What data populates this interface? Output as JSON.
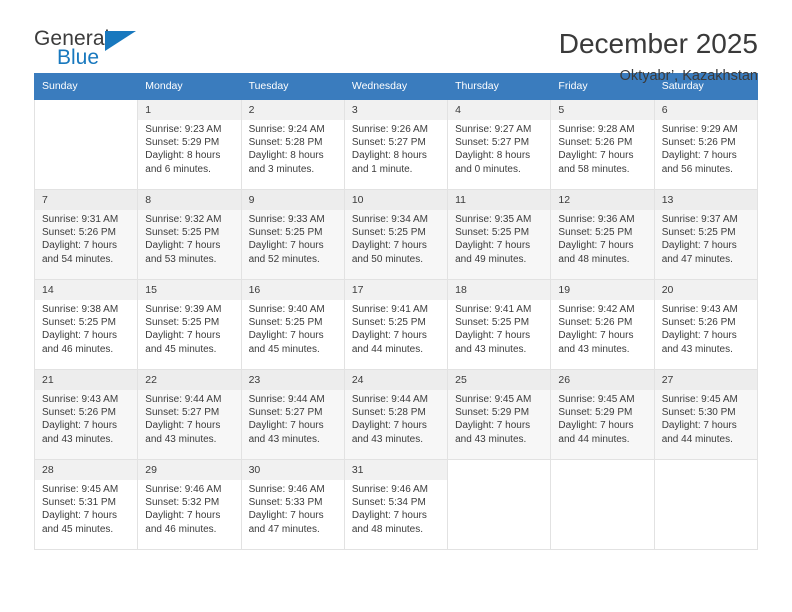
{
  "logo": {
    "word_one": "General",
    "word_two": "Blue",
    "triangle_icon": "triangle-icon",
    "brand_color": "#1878be"
  },
  "header": {
    "title": "December 2025",
    "subtitle": "Oktyabr’, Kazakhstan"
  },
  "calendar": {
    "header_bg": "#3a7cbe",
    "weekdays": [
      "Sunday",
      "Monday",
      "Tuesday",
      "Wednesday",
      "Thursday",
      "Friday",
      "Saturday"
    ],
    "weeks": [
      [
        {
          "day": "",
          "sunrise": "",
          "sunset": "",
          "daylight1": "",
          "daylight2": ""
        },
        {
          "day": "1",
          "sunrise": "Sunrise: 9:23 AM",
          "sunset": "Sunset: 5:29 PM",
          "daylight1": "Daylight: 8 hours",
          "daylight2": "and 6 minutes."
        },
        {
          "day": "2",
          "sunrise": "Sunrise: 9:24 AM",
          "sunset": "Sunset: 5:28 PM",
          "daylight1": "Daylight: 8 hours",
          "daylight2": "and 3 minutes."
        },
        {
          "day": "3",
          "sunrise": "Sunrise: 9:26 AM",
          "sunset": "Sunset: 5:27 PM",
          "daylight1": "Daylight: 8 hours",
          "daylight2": "and 1 minute."
        },
        {
          "day": "4",
          "sunrise": "Sunrise: 9:27 AM",
          "sunset": "Sunset: 5:27 PM",
          "daylight1": "Daylight: 8 hours",
          "daylight2": "and 0 minutes."
        },
        {
          "day": "5",
          "sunrise": "Sunrise: 9:28 AM",
          "sunset": "Sunset: 5:26 PM",
          "daylight1": "Daylight: 7 hours",
          "daylight2": "and 58 minutes."
        },
        {
          "day": "6",
          "sunrise": "Sunrise: 9:29 AM",
          "sunset": "Sunset: 5:26 PM",
          "daylight1": "Daylight: 7 hours",
          "daylight2": "and 56 minutes."
        }
      ],
      [
        {
          "day": "7",
          "sunrise": "Sunrise: 9:31 AM",
          "sunset": "Sunset: 5:26 PM",
          "daylight1": "Daylight: 7 hours",
          "daylight2": "and 54 minutes."
        },
        {
          "day": "8",
          "sunrise": "Sunrise: 9:32 AM",
          "sunset": "Sunset: 5:25 PM",
          "daylight1": "Daylight: 7 hours",
          "daylight2": "and 53 minutes."
        },
        {
          "day": "9",
          "sunrise": "Sunrise: 9:33 AM",
          "sunset": "Sunset: 5:25 PM",
          "daylight1": "Daylight: 7 hours",
          "daylight2": "and 52 minutes."
        },
        {
          "day": "10",
          "sunrise": "Sunrise: 9:34 AM",
          "sunset": "Sunset: 5:25 PM",
          "daylight1": "Daylight: 7 hours",
          "daylight2": "and 50 minutes."
        },
        {
          "day": "11",
          "sunrise": "Sunrise: 9:35 AM",
          "sunset": "Sunset: 5:25 PM",
          "daylight1": "Daylight: 7 hours",
          "daylight2": "and 49 minutes."
        },
        {
          "day": "12",
          "sunrise": "Sunrise: 9:36 AM",
          "sunset": "Sunset: 5:25 PM",
          "daylight1": "Daylight: 7 hours",
          "daylight2": "and 48 minutes."
        },
        {
          "day": "13",
          "sunrise": "Sunrise: 9:37 AM",
          "sunset": "Sunset: 5:25 PM",
          "daylight1": "Daylight: 7 hours",
          "daylight2": "and 47 minutes."
        }
      ],
      [
        {
          "day": "14",
          "sunrise": "Sunrise: 9:38 AM",
          "sunset": "Sunset: 5:25 PM",
          "daylight1": "Daylight: 7 hours",
          "daylight2": "and 46 minutes."
        },
        {
          "day": "15",
          "sunrise": "Sunrise: 9:39 AM",
          "sunset": "Sunset: 5:25 PM",
          "daylight1": "Daylight: 7 hours",
          "daylight2": "and 45 minutes."
        },
        {
          "day": "16",
          "sunrise": "Sunrise: 9:40 AM",
          "sunset": "Sunset: 5:25 PM",
          "daylight1": "Daylight: 7 hours",
          "daylight2": "and 45 minutes."
        },
        {
          "day": "17",
          "sunrise": "Sunrise: 9:41 AM",
          "sunset": "Sunset: 5:25 PM",
          "daylight1": "Daylight: 7 hours",
          "daylight2": "and 44 minutes."
        },
        {
          "day": "18",
          "sunrise": "Sunrise: 9:41 AM",
          "sunset": "Sunset: 5:25 PM",
          "daylight1": "Daylight: 7 hours",
          "daylight2": "and 43 minutes."
        },
        {
          "day": "19",
          "sunrise": "Sunrise: 9:42 AM",
          "sunset": "Sunset: 5:26 PM",
          "daylight1": "Daylight: 7 hours",
          "daylight2": "and 43 minutes."
        },
        {
          "day": "20",
          "sunrise": "Sunrise: 9:43 AM",
          "sunset": "Sunset: 5:26 PM",
          "daylight1": "Daylight: 7 hours",
          "daylight2": "and 43 minutes."
        }
      ],
      [
        {
          "day": "21",
          "sunrise": "Sunrise: 9:43 AM",
          "sunset": "Sunset: 5:26 PM",
          "daylight1": "Daylight: 7 hours",
          "daylight2": "and 43 minutes."
        },
        {
          "day": "22",
          "sunrise": "Sunrise: 9:44 AM",
          "sunset": "Sunset: 5:27 PM",
          "daylight1": "Daylight: 7 hours",
          "daylight2": "and 43 minutes."
        },
        {
          "day": "23",
          "sunrise": "Sunrise: 9:44 AM",
          "sunset": "Sunset: 5:27 PM",
          "daylight1": "Daylight: 7 hours",
          "daylight2": "and 43 minutes."
        },
        {
          "day": "24",
          "sunrise": "Sunrise: 9:44 AM",
          "sunset": "Sunset: 5:28 PM",
          "daylight1": "Daylight: 7 hours",
          "daylight2": "and 43 minutes."
        },
        {
          "day": "25",
          "sunrise": "Sunrise: 9:45 AM",
          "sunset": "Sunset: 5:29 PM",
          "daylight1": "Daylight: 7 hours",
          "daylight2": "and 43 minutes."
        },
        {
          "day": "26",
          "sunrise": "Sunrise: 9:45 AM",
          "sunset": "Sunset: 5:29 PM",
          "daylight1": "Daylight: 7 hours",
          "daylight2": "and 44 minutes."
        },
        {
          "day": "27",
          "sunrise": "Sunrise: 9:45 AM",
          "sunset": "Sunset: 5:30 PM",
          "daylight1": "Daylight: 7 hours",
          "daylight2": "and 44 minutes."
        }
      ],
      [
        {
          "day": "28",
          "sunrise": "Sunrise: 9:45 AM",
          "sunset": "Sunset: 5:31 PM",
          "daylight1": "Daylight: 7 hours",
          "daylight2": "and 45 minutes."
        },
        {
          "day": "29",
          "sunrise": "Sunrise: 9:46 AM",
          "sunset": "Sunset: 5:32 PM",
          "daylight1": "Daylight: 7 hours",
          "daylight2": "and 46 minutes."
        },
        {
          "day": "30",
          "sunrise": "Sunrise: 9:46 AM",
          "sunset": "Sunset: 5:33 PM",
          "daylight1": "Daylight: 7 hours",
          "daylight2": "and 47 minutes."
        },
        {
          "day": "31",
          "sunrise": "Sunrise: 9:46 AM",
          "sunset": "Sunset: 5:34 PM",
          "daylight1": "Daylight: 7 hours",
          "daylight2": "and 48 minutes."
        },
        {
          "day": "",
          "sunrise": "",
          "sunset": "",
          "daylight1": "",
          "daylight2": ""
        },
        {
          "day": "",
          "sunrise": "",
          "sunset": "",
          "daylight1": "",
          "daylight2": ""
        },
        {
          "day": "",
          "sunrise": "",
          "sunset": "",
          "daylight1": "",
          "daylight2": ""
        }
      ]
    ]
  }
}
